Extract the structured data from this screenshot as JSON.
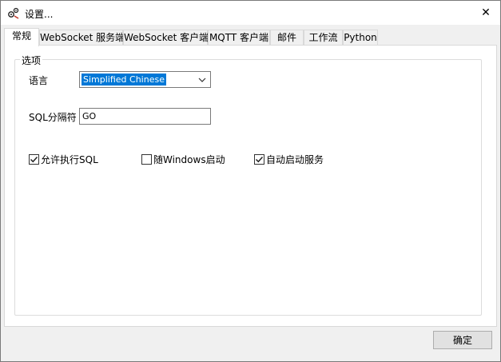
{
  "window": {
    "title": "设置...",
    "close_glyph": "✕"
  },
  "tabs": [
    {
      "label": "常规",
      "active": true
    },
    {
      "label": "WebSocket 服务端",
      "active": false
    },
    {
      "label": "WebSocket 客户端",
      "active": false
    },
    {
      "label": "MQTT 客户端",
      "active": false
    },
    {
      "label": "邮件",
      "active": false
    },
    {
      "label": "工作流",
      "active": false
    },
    {
      "label": "Python",
      "active": false
    }
  ],
  "options_group": {
    "legend": "选项",
    "language": {
      "label": "语言",
      "selected": "Simplified Chinese"
    },
    "sql_separator": {
      "label": "SQL分隔符",
      "value": "GO"
    },
    "checkboxes": [
      {
        "label": "允许执行SQL",
        "checked": true
      },
      {
        "label": "随Windows启动",
        "checked": false
      },
      {
        "label": "自动启动服务",
        "checked": true
      }
    ]
  },
  "footer": {
    "ok_label": "确定"
  },
  "colors": {
    "selection_highlight": "#0078d7",
    "button_face": "#e1e1e1",
    "window_background": "#f0f0f0"
  }
}
